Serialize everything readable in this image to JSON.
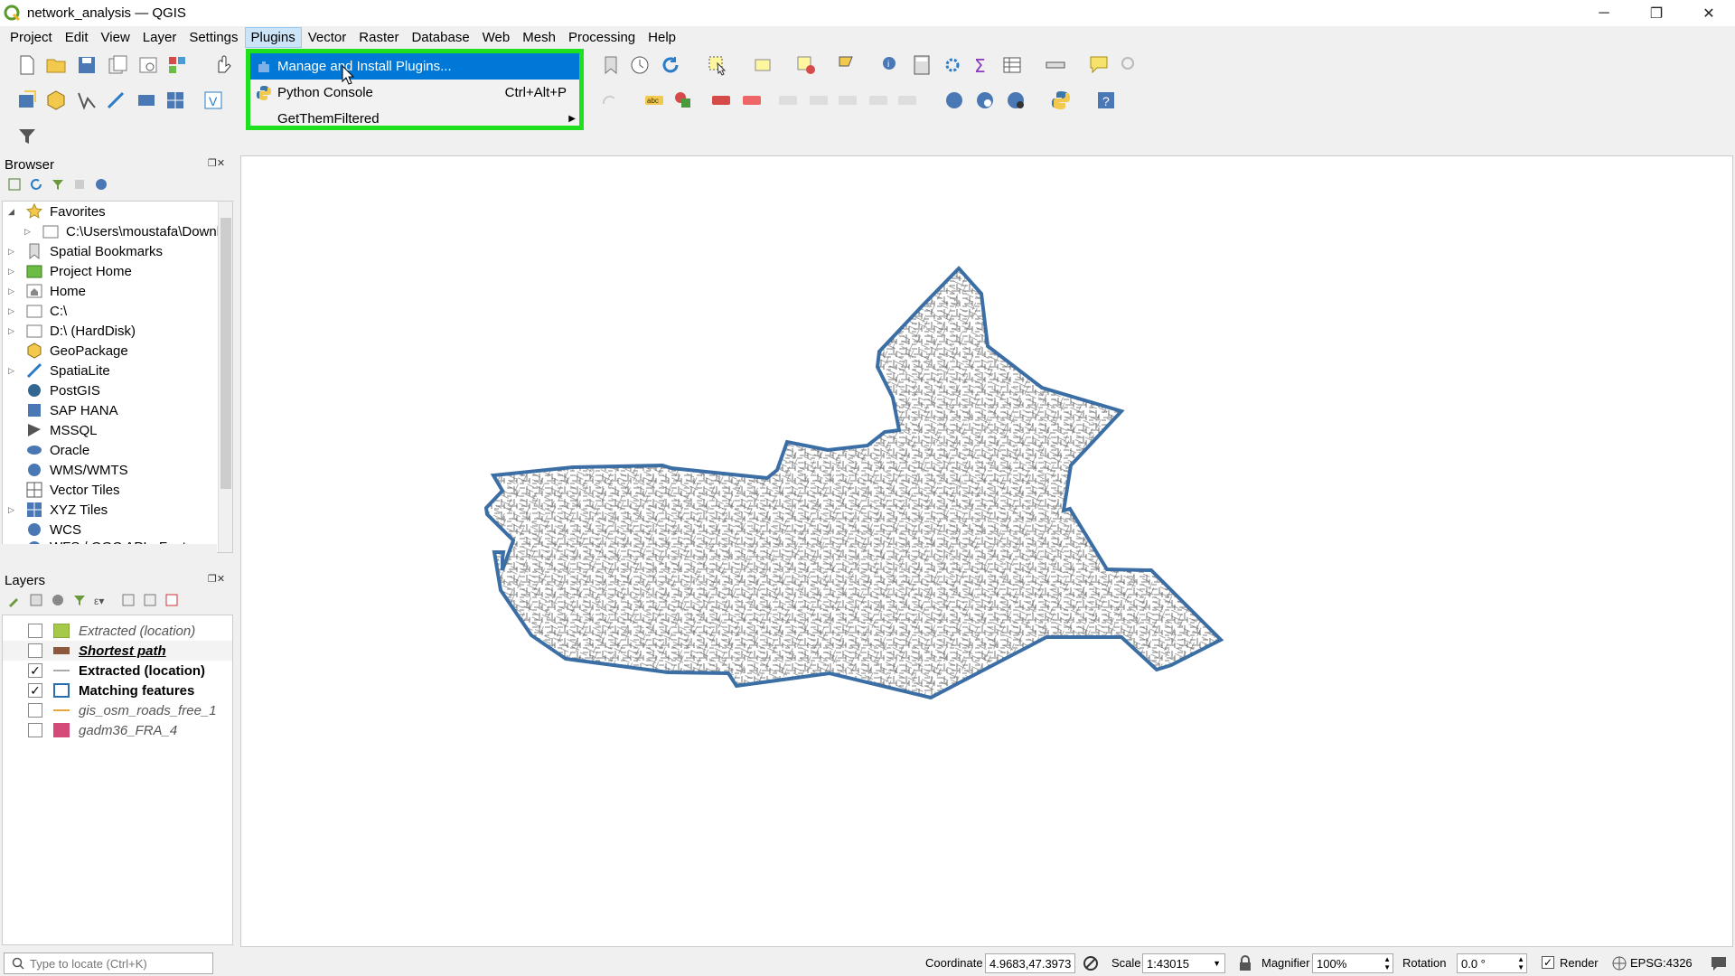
{
  "window": {
    "title": "network_analysis — QGIS",
    "controls": {
      "minimize": "─",
      "maximize": "❐",
      "close": "✕"
    }
  },
  "menubar": {
    "items": [
      "Project",
      "Edit",
      "View",
      "Layer",
      "Settings",
      "Plugins",
      "Vector",
      "Raster",
      "Database",
      "Web",
      "Mesh",
      "Processing",
      "Help"
    ],
    "active": "Plugins"
  },
  "plugins_menu": {
    "items": [
      {
        "label": "Manage and Install Plugins...",
        "shortcut": "",
        "highlighted": true
      },
      {
        "label": "Python Console",
        "shortcut": "Ctrl+Alt+P",
        "highlighted": false
      },
      {
        "label": "GetThemFiltered",
        "shortcut": "",
        "submenu": true
      }
    ],
    "highlight_color": "#1ee01e"
  },
  "browser": {
    "title": "Browser",
    "items": [
      {
        "label": "Favorites",
        "icon": "star-icon",
        "expanded": true,
        "indent": 0
      },
      {
        "label": "C:\\Users\\moustafa\\Downlc",
        "icon": "folder-icon",
        "indent": 1
      },
      {
        "label": "Spatial Bookmarks",
        "icon": "bookmark-icon",
        "indent": 0
      },
      {
        "label": "Project Home",
        "icon": "project-home-icon",
        "indent": 0
      },
      {
        "label": "Home",
        "icon": "home-icon",
        "indent": 0
      },
      {
        "label": "C:\\",
        "icon": "drive-icon",
        "indent": 0
      },
      {
        "label": "D:\\ (HardDisk)",
        "icon": "drive-icon",
        "indent": 0
      },
      {
        "label": "GeoPackage",
        "icon": "geopackage-icon",
        "indent": 0
      },
      {
        "label": "SpatiaLite",
        "icon": "spatialite-icon",
        "indent": 0
      },
      {
        "label": "PostGIS",
        "icon": "postgis-icon",
        "indent": 0
      },
      {
        "label": "SAP HANA",
        "icon": "saphana-icon",
        "indent": 0
      },
      {
        "label": "MSSQL",
        "icon": "mssql-icon",
        "indent": 0
      },
      {
        "label": "Oracle",
        "icon": "oracle-icon",
        "indent": 0
      },
      {
        "label": "WMS/WMTS",
        "icon": "wms-icon",
        "indent": 0
      },
      {
        "label": "Vector Tiles",
        "icon": "vector-tiles-icon",
        "indent": 0
      },
      {
        "label": "XYZ Tiles",
        "icon": "xyz-tiles-icon",
        "indent": 0
      },
      {
        "label": "WCS",
        "icon": "wcs-icon",
        "indent": 0
      },
      {
        "label": "WFS / OGC API - Features",
        "icon": "wfs-icon",
        "indent": 0
      }
    ]
  },
  "layers": {
    "title": "Layers",
    "items": [
      {
        "label": "Extracted (location)",
        "checked": false,
        "style": "italic",
        "color": "#a6c94a"
      },
      {
        "label": "Shortest path",
        "checked": false,
        "style": "bold-italic-underline",
        "color": "#8b5a3c"
      },
      {
        "label": "Extracted (location)",
        "checked": true,
        "style": "bold",
        "color": "#888888"
      },
      {
        "label": "Matching features",
        "checked": true,
        "style": "bold",
        "color": "#2a6db0"
      },
      {
        "label": "gis_osm_roads_free_1",
        "checked": false,
        "style": "italic",
        "color": "#e8a53b"
      },
      {
        "label": "gadm36_FRA_4",
        "checked": false,
        "style": "italic",
        "color": "#d64a7a"
      }
    ]
  },
  "statusbar": {
    "locator_placeholder": "Type to locate (Ctrl+K)",
    "coordinate_label": "Coordinate",
    "coordinate_value": "4.9683,47.3973",
    "scale_label": "Scale",
    "scale_value": "1:43015",
    "magnifier_label": "Magnifier",
    "magnifier_value": "100%",
    "rotation_label": "Rotation",
    "rotation_value": "0.0 °",
    "render_label": "Render",
    "crs": "EPSG:4326"
  },
  "map": {
    "polygon_color": "#3a6ea5"
  }
}
